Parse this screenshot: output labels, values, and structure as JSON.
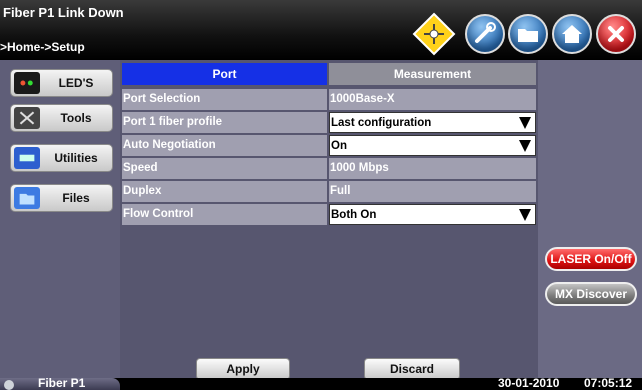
{
  "header": {
    "title": "Fiber P1 Link Down",
    "breadcrumb": ">Home->Setup",
    "icons": [
      "warning-icon",
      "tools-icon",
      "folder-icon",
      "home-icon",
      "close-icon"
    ]
  },
  "sidebar": {
    "items": [
      {
        "label": "LED'S",
        "icon": "led-icon"
      },
      {
        "label": "Tools",
        "icon": "tools-icon"
      },
      {
        "label": "Utilities",
        "icon": "utilities-icon"
      },
      {
        "label": "Files",
        "icon": "files-icon"
      }
    ]
  },
  "tabs": {
    "port": "Port",
    "measurement": "Measurement"
  },
  "rows": [
    {
      "label": "Port Selection",
      "value": "1000Base-X",
      "editable": false
    },
    {
      "label": "Port 1 fiber profile",
      "value": "Last configuration",
      "editable": true
    },
    {
      "label": "Auto Negotiation",
      "value": "On",
      "editable": true
    },
    {
      "label": "Speed",
      "value": "1000 Mbps",
      "editable": false
    },
    {
      "label": "Duplex",
      "value": "Full",
      "editable": false
    },
    {
      "label": "Flow Control",
      "value": "Both On",
      "editable": true
    }
  ],
  "actions": {
    "apply": "Apply",
    "discard": "Discard"
  },
  "right_panel": {
    "laser": "LASER On/Off",
    "mx": "MX Discover"
  },
  "status": {
    "port": "Fiber P1",
    "date": "30-01-2010",
    "time": "07:05:12"
  },
  "colors": {
    "active_tab": "#1530e6",
    "laser": "#d11111",
    "background": "#6b6a84"
  }
}
